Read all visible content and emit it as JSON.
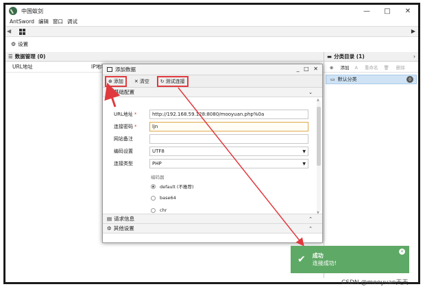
{
  "window": {
    "title": "中国蚁剑",
    "controls": [
      "—",
      "□",
      "✕"
    ]
  },
  "menu": [
    "AntSword",
    "编辑",
    "窗口",
    "调试"
  ],
  "tabs": {
    "left_arrow": "◀",
    "right_arrow": "▶"
  },
  "settings_label": "设置",
  "left_panel": {
    "title": "数据管理 (0)",
    "col_url": "URL地址",
    "col_ip": "IP地址"
  },
  "right_panel": {
    "title": "分类目录 (1)",
    "add": "添加",
    "rename": "重命名",
    "delete": "删除",
    "category": "默认分类",
    "category_count": "0"
  },
  "dialog": {
    "title": "添加数据",
    "btn_add": "添加",
    "btn_clear": "清空",
    "btn_test": "测试连接",
    "section_basic": "基础配置",
    "fields": {
      "url_label": "URL地址",
      "url_value": "http://192.168.59.128:8080/mooyuan.php%0a",
      "pwd_label": "连接密码",
      "pwd_value": "ljn",
      "note_label": "网站备注",
      "note_value": "",
      "enc_label": "编码设置",
      "enc_value": "UTF8",
      "type_label": "连接类型",
      "type_value": "PHP"
    },
    "encoder_title": "编码器",
    "encoders": [
      "default (不推荐)",
      "base64",
      "chr"
    ],
    "section_request": "请求信息",
    "section_other": "其他设置"
  },
  "toast": {
    "title": "成功",
    "message": "连接成功!"
  },
  "watermark": "CSDN @mooyuan天天",
  "colors": {
    "highlight": "#e0393e",
    "toast": "#5fa966",
    "selected": "#cfe3f5"
  }
}
